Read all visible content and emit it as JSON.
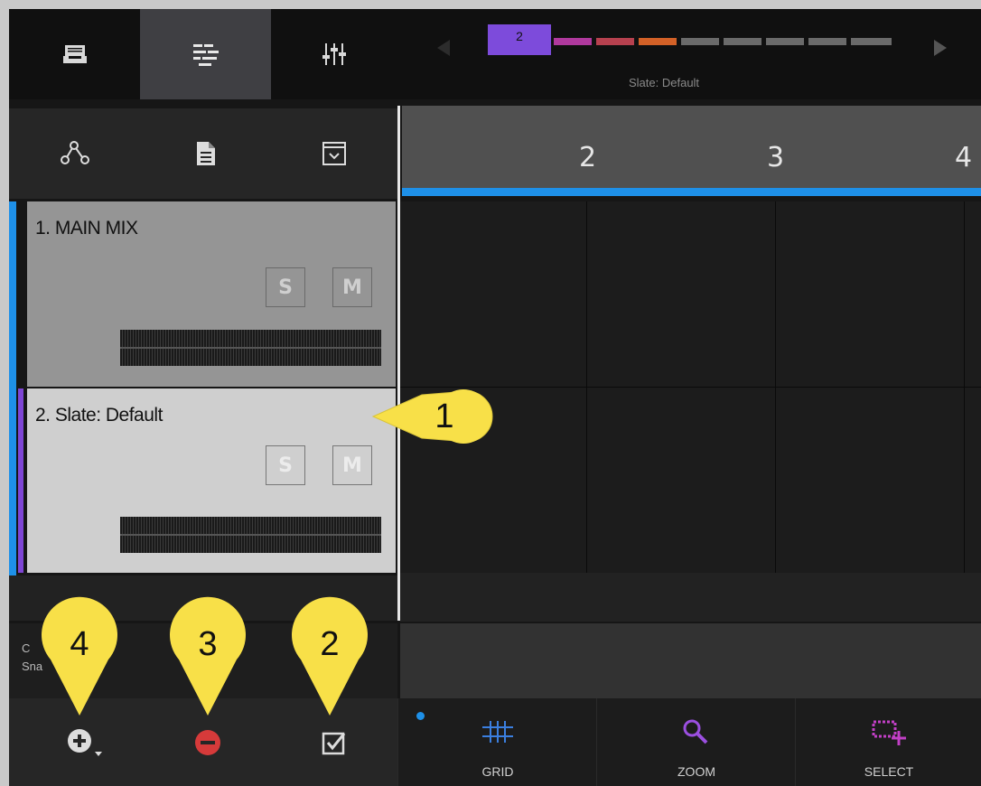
{
  "navigator": {
    "current_scene": "2",
    "slate_label": "Slate: Default",
    "scene_colors": [
      "#7d4bdb",
      "#b0399e",
      "#b7414f",
      "#d36127",
      "#6a6a6a",
      "#6a6a6a",
      "#6a6a6a",
      "#6a6a6a"
    ]
  },
  "ruler": {
    "marks": [
      "2",
      "3",
      "4"
    ]
  },
  "tracks": [
    {
      "name": "1. MAIN MIX",
      "solo": "S",
      "mute": "M",
      "color": "#1e90e8"
    },
    {
      "name": "2. Slate: Default",
      "solo": "S",
      "mute": "M",
      "color": "#7e45d4"
    }
  ],
  "info": {
    "line1": "C",
    "line2": "Sna"
  },
  "tools": [
    {
      "label": "GRID",
      "icon": "grid-icon",
      "color": "#3b7fe0"
    },
    {
      "label": "ZOOM",
      "icon": "zoom-icon",
      "color": "#9b4fe0"
    },
    {
      "label": "SELECT",
      "icon": "select-icon",
      "color": "#c23fc6"
    }
  ],
  "callouts": {
    "c1": "1",
    "c2": "2",
    "c3": "3",
    "c4": "4"
  },
  "colors": {
    "callout": "#f8e048",
    "remove": "#d63a3a",
    "accent": "#1e90e8"
  }
}
